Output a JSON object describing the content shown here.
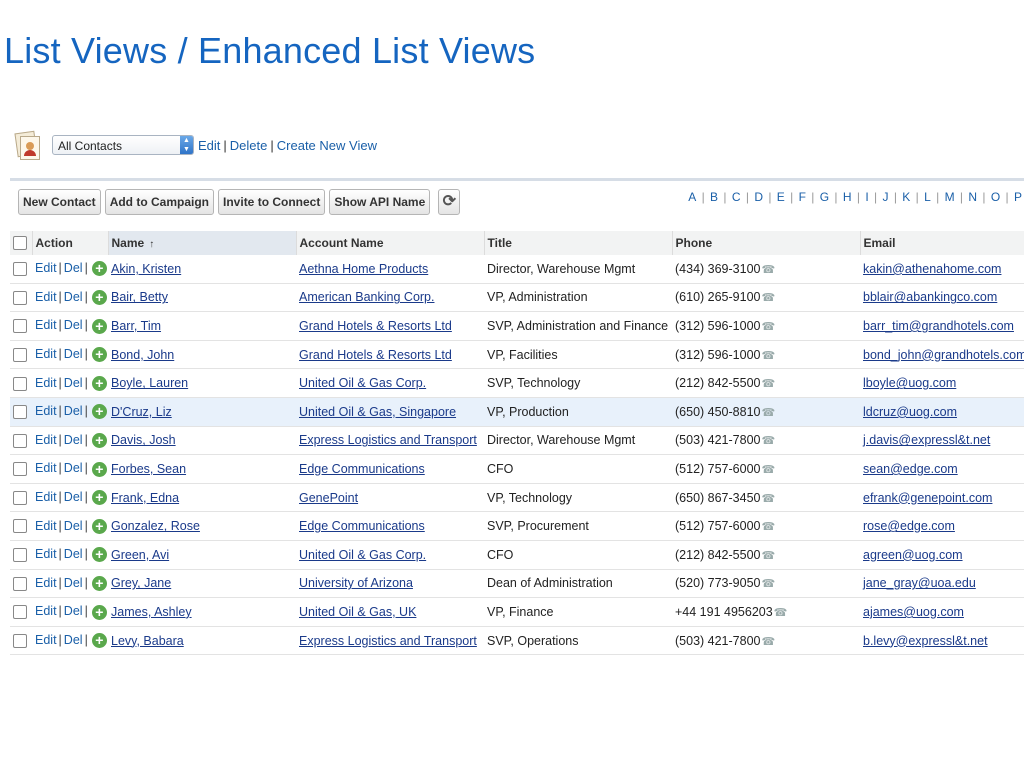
{
  "slide_title": "List Views / Enhanced List Views",
  "view_selector": {
    "selected": "All Contacts",
    "links": [
      "Edit",
      "Delete",
      "Create New View"
    ]
  },
  "toolbar": {
    "buttons": [
      "New Contact",
      "Add to Campaign",
      "Invite to Connect",
      "Show API Name"
    ],
    "refresh_icon": "refresh-icon"
  },
  "alphabet": [
    "A",
    "B",
    "C",
    "D",
    "E",
    "F",
    "G",
    "H",
    "I",
    "J",
    "K",
    "L",
    "M",
    "N",
    "O",
    "P"
  ],
  "columns": [
    "Action",
    "Name",
    "Account Name",
    "Title",
    "Phone",
    "Email"
  ],
  "sort_indicator": "↑",
  "row_actions": {
    "edit": "Edit",
    "del": "Del"
  },
  "rows": [
    {
      "name": "Akin, Kristen",
      "account": "Aethna Home Products",
      "title": "Director, Warehouse Mgmt",
      "phone": "(434) 369-3100",
      "email": "kakin@athenahome.com"
    },
    {
      "name": "Bair, Betty",
      "account": "American Banking Corp.",
      "title": "VP, Administration",
      "phone": "(610) 265-9100",
      "email": "bblair@abankingco.com"
    },
    {
      "name": "Barr, Tim",
      "account": "Grand Hotels & Resorts Ltd",
      "title": "SVP, Administration and Finance",
      "phone": "(312) 596-1000",
      "email": "barr_tim@grandhotels.com"
    },
    {
      "name": "Bond, John",
      "account": "Grand Hotels & Resorts Ltd",
      "title": "VP, Facilities",
      "phone": "(312) 596-1000",
      "email": "bond_john@grandhotels.com"
    },
    {
      "name": "Boyle, Lauren",
      "account": "United Oil & Gas Corp.",
      "title": "SVP, Technology",
      "phone": "(212) 842-5500",
      "email": "lboyle@uog.com"
    },
    {
      "name": "D'Cruz, Liz",
      "account": "United Oil & Gas, Singapore",
      "title": "VP, Production",
      "phone": "(650) 450-8810",
      "email": "ldcruz@uog.com"
    },
    {
      "name": "Davis, Josh",
      "account": "Express Logistics and Transport",
      "title": "Director, Warehouse Mgmt",
      "phone": "(503) 421-7800",
      "email": "j.davis@expressl&t.net"
    },
    {
      "name": "Forbes, Sean",
      "account": "Edge Communications",
      "title": "CFO",
      "phone": "(512) 757-6000",
      "email": "sean@edge.com"
    },
    {
      "name": "Frank, Edna",
      "account": "GenePoint",
      "title": "VP, Technology",
      "phone": "(650) 867-3450",
      "email": "efrank@genepoint.com"
    },
    {
      "name": "Gonzalez, Rose",
      "account": "Edge Communications",
      "title": "SVP, Procurement",
      "phone": "(512) 757-6000",
      "email": "rose@edge.com"
    },
    {
      "name": "Green, Avi",
      "account": "United Oil & Gas Corp.",
      "title": "CFO",
      "phone": "(212) 842-5500",
      "email": "agreen@uog.com"
    },
    {
      "name": "Grey, Jane",
      "account": "University of Arizona",
      "title": "Dean of Administration",
      "phone": "(520) 773-9050",
      "email": "jane_gray@uoa.edu"
    },
    {
      "name": "James, Ashley",
      "account": "United Oil & Gas, UK",
      "title": "VP, Finance",
      "phone": "+44 191 4956203",
      "email": "ajames@uog.com"
    },
    {
      "name": "Levy, Babara",
      "account": "Express Logistics and Transport",
      "title": "SVP, Operations",
      "phone": "(503) 421-7800",
      "email": "b.levy@expressl&t.net"
    }
  ],
  "highlighted_row_index": 5,
  "colors": {
    "title_blue": "#1565c0",
    "link_blue": "#1a5fa8",
    "plus_green": "#5aa84c",
    "highlight": "#e8f1fb"
  }
}
